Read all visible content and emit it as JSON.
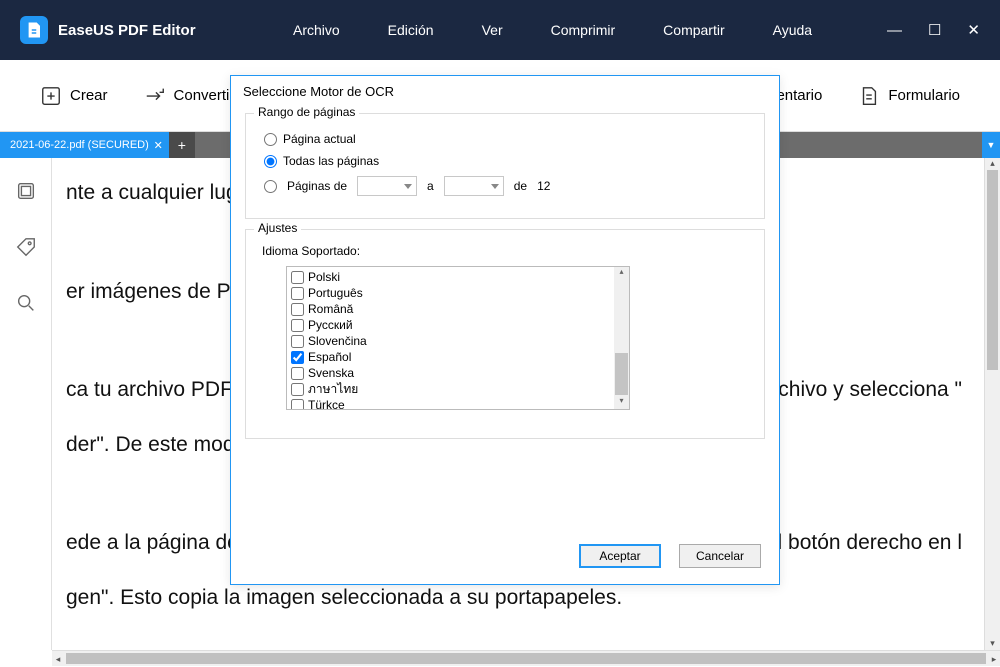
{
  "app": {
    "title": "EaseUS PDF Editor"
  },
  "menu": {
    "file": "Archivo",
    "edit": "Edición",
    "view": "Ver",
    "compress": "Comprimir",
    "share": "Compartir",
    "help": "Ayuda"
  },
  "toolbar": {
    "create": "Crear",
    "convert": "Convertir",
    "comment_partial": "omentario",
    "form": "Formulario"
  },
  "tab": {
    "name": "2021-06-22.pdf (SECURED)"
  },
  "doc_text": {
    "l1": "nte a cualquier luga",
    "l2": "er imágenes de PDI",
    "l3a": "ca tu archivo PDF e",
    "l3b": "el archivo y selecciona \"",
    "l4": "der\". De este modo",
    "l5a": "ede a la página do",
    "l5b": "n el botón derecho en l",
    "l6": "gen\". Esto copia la imagen seleccionada a su portapapeles."
  },
  "dialog": {
    "title": "Seleccione Motor de OCR",
    "range_legend": "Rango de páginas",
    "opt_current": "Página actual",
    "opt_all": "Todas las páginas",
    "opt_from": "Páginas de",
    "to_label": "a",
    "of_label": "de",
    "total_pages": "12",
    "settings_legend": "Ajustes",
    "lang_label": "Idioma Soportado:",
    "languages": [
      {
        "name": "Polski",
        "checked": false
      },
      {
        "name": "Português",
        "checked": false
      },
      {
        "name": "Română",
        "checked": false
      },
      {
        "name": "Русский",
        "checked": false
      },
      {
        "name": "Slovenčina",
        "checked": false
      },
      {
        "name": "Español",
        "checked": true
      },
      {
        "name": "Svenska",
        "checked": false
      },
      {
        "name": "ภาษาไทย",
        "checked": false
      },
      {
        "name": "Türkçe",
        "checked": false
      }
    ],
    "ok": "Aceptar",
    "cancel": "Cancelar"
  }
}
